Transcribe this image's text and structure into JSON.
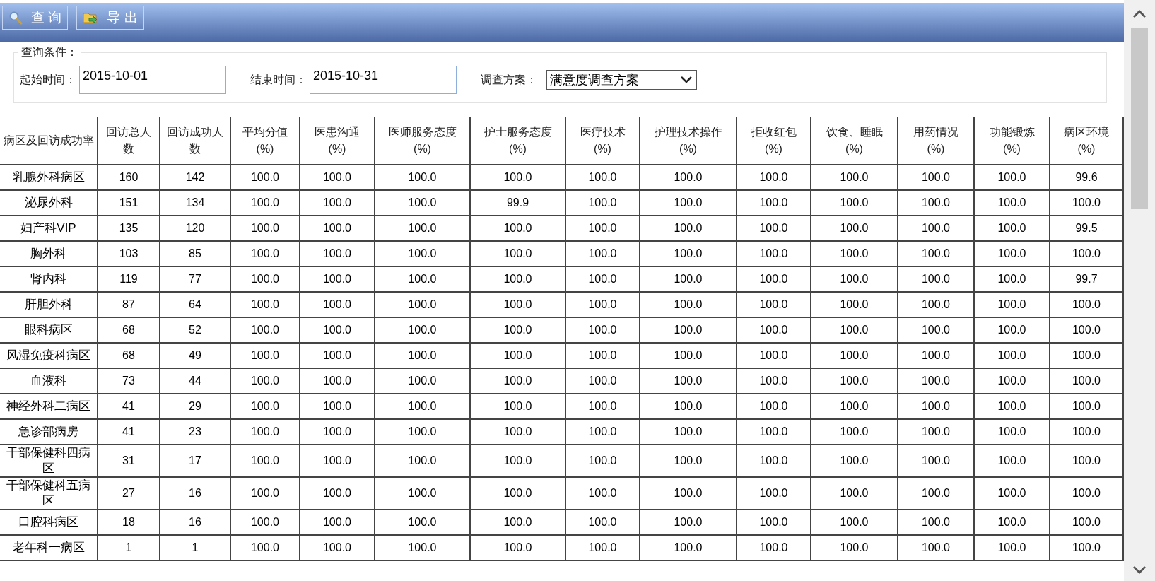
{
  "toolbar": {
    "buttons": [
      {
        "kind": "search",
        "label": "查 询"
      },
      {
        "kind": "export",
        "label": "导 出"
      }
    ]
  },
  "query": {
    "legend": "查询条件：",
    "fields": [
      {
        "kind": "text",
        "label": "起始时间：",
        "value": "2015-10-01"
      },
      {
        "kind": "text",
        "label": "结束时间：",
        "value": "2015-10-31"
      },
      {
        "kind": "select",
        "label": "调查方案：",
        "value": "满意度调查方案"
      }
    ]
  },
  "table": {
    "columns": [
      {
        "label": "病区及回访成功率"
      },
      {
        "label": "回访总人数"
      },
      {
        "label": "回访成功人数"
      },
      {
        "label": "平均分值",
        "unit": "(%)"
      },
      {
        "label": "医患沟通",
        "unit": "(%)"
      },
      {
        "label": "医师服务态度",
        "unit": "(%)"
      },
      {
        "label": "护士服务态度",
        "unit": "(%)"
      },
      {
        "label": "医疗技术",
        "unit": "(%)"
      },
      {
        "label": "护理技术操作",
        "unit": "(%)"
      },
      {
        "label": "拒收红包",
        "unit": "(%)"
      },
      {
        "label": "饮食、睡眠",
        "unit": "(%)"
      },
      {
        "label": "用药情况",
        "unit": "(%)"
      },
      {
        "label": "功能锻炼",
        "unit": "(%)"
      },
      {
        "label": "病区环境",
        "unit": "(%)"
      }
    ],
    "rows": [
      {
        "cells": [
          "乳腺外科病区",
          "160",
          "142",
          "100.0",
          "100.0",
          "100.0",
          "100.0",
          "100.0",
          "100.0",
          "100.0",
          "100.0",
          "100.0",
          "100.0",
          "99.6"
        ]
      },
      {
        "cells": [
          "泌尿外科",
          "151",
          "134",
          "100.0",
          "100.0",
          "100.0",
          "99.9",
          "100.0",
          "100.0",
          "100.0",
          "100.0",
          "100.0",
          "100.0",
          "100.0"
        ]
      },
      {
        "cells": [
          "妇产科VIP",
          "135",
          "120",
          "100.0",
          "100.0",
          "100.0",
          "100.0",
          "100.0",
          "100.0",
          "100.0",
          "100.0",
          "100.0",
          "100.0",
          "99.5"
        ]
      },
      {
        "cells": [
          "胸外科",
          "103",
          "85",
          "100.0",
          "100.0",
          "100.0",
          "100.0",
          "100.0",
          "100.0",
          "100.0",
          "100.0",
          "100.0",
          "100.0",
          "100.0"
        ]
      },
      {
        "cells": [
          "肾内科",
          "119",
          "77",
          "100.0",
          "100.0",
          "100.0",
          "100.0",
          "100.0",
          "100.0",
          "100.0",
          "100.0",
          "100.0",
          "100.0",
          "99.7"
        ]
      },
      {
        "cells": [
          "肝胆外科",
          "87",
          "64",
          "100.0",
          "100.0",
          "100.0",
          "100.0",
          "100.0",
          "100.0",
          "100.0",
          "100.0",
          "100.0",
          "100.0",
          "100.0"
        ]
      },
      {
        "cells": [
          "眼科病区",
          "68",
          "52",
          "100.0",
          "100.0",
          "100.0",
          "100.0",
          "100.0",
          "100.0",
          "100.0",
          "100.0",
          "100.0",
          "100.0",
          "100.0"
        ]
      },
      {
        "cells": [
          "风湿免疫科病区",
          "68",
          "49",
          "100.0",
          "100.0",
          "100.0",
          "100.0",
          "100.0",
          "100.0",
          "100.0",
          "100.0",
          "100.0",
          "100.0",
          "100.0"
        ]
      },
      {
        "cells": [
          "血液科",
          "73",
          "44",
          "100.0",
          "100.0",
          "100.0",
          "100.0",
          "100.0",
          "100.0",
          "100.0",
          "100.0",
          "100.0",
          "100.0",
          "100.0"
        ]
      },
      {
        "cells": [
          "神经外科二病区",
          "41",
          "29",
          "100.0",
          "100.0",
          "100.0",
          "100.0",
          "100.0",
          "100.0",
          "100.0",
          "100.0",
          "100.0",
          "100.0",
          "100.0"
        ]
      },
      {
        "cells": [
          "急诊部病房",
          "41",
          "23",
          "100.0",
          "100.0",
          "100.0",
          "100.0",
          "100.0",
          "100.0",
          "100.0",
          "100.0",
          "100.0",
          "100.0",
          "100.0"
        ]
      },
      {
        "cells": [
          "干部保健科四病区",
          "31",
          "17",
          "100.0",
          "100.0",
          "100.0",
          "100.0",
          "100.0",
          "100.0",
          "100.0",
          "100.0",
          "100.0",
          "100.0",
          "100.0"
        ]
      },
      {
        "cells": [
          "干部保健科五病区",
          "27",
          "16",
          "100.0",
          "100.0",
          "100.0",
          "100.0",
          "100.0",
          "100.0",
          "100.0",
          "100.0",
          "100.0",
          "100.0",
          "100.0"
        ]
      },
      {
        "cells": [
          "口腔科病区",
          "18",
          "16",
          "100.0",
          "100.0",
          "100.0",
          "100.0",
          "100.0",
          "100.0",
          "100.0",
          "100.0",
          "100.0",
          "100.0",
          "100.0"
        ]
      },
      {
        "cells": [
          "老年科一病区",
          "1",
          "1",
          "100.0",
          "100.0",
          "100.0",
          "100.0",
          "100.0",
          "100.0",
          "100.0",
          "100.0",
          "100.0",
          "100.0",
          "100.0"
        ]
      }
    ]
  }
}
